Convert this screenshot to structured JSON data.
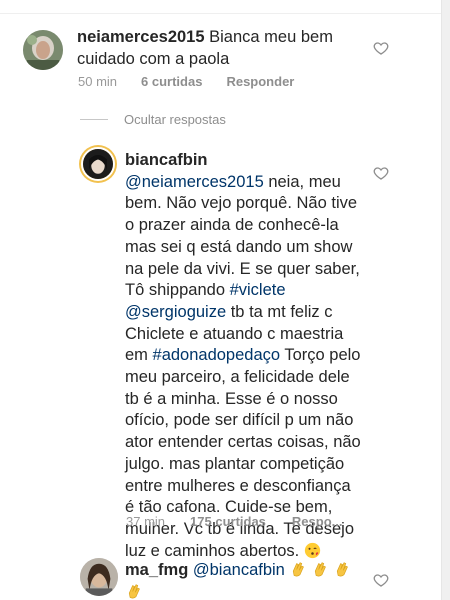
{
  "comments": [
    {
      "username": "neiamerces2015",
      "text": "Bianca meu bem cuidado com a paola",
      "time": "50 min",
      "likes": "6 curtidas",
      "reply": "Responder"
    }
  ],
  "hide_replies_label": "Ocultar respostas",
  "reply": {
    "username": "biancafbin",
    "parts": [
      {
        "type": "mention",
        "text": "@neiamerces2015"
      },
      {
        "type": "text",
        "text": " neia, meu bem. Não vejo porquê. Não tive o prazer ainda de conhecê-la mas sei q está dando um show na pele da vivi. E se quer saber, Tô shippando "
      },
      {
        "type": "hashtag",
        "text": "#viclete"
      },
      {
        "type": "text",
        "text": " "
      },
      {
        "type": "mention",
        "text": "@sergioguize"
      },
      {
        "type": "text",
        "text": " tb ta mt feliz c Chiclete e atuando c maestria em "
      },
      {
        "type": "hashtag",
        "text": "#adonadopedaço"
      },
      {
        "type": "text",
        "text": " Torço pelo meu parceiro, a felicidade dele tb é a minha.  Esse é o nosso ofício, pode ser difícil p um não ator entender certas coisas, não julgo. mas plantar competição entre mulheres e desconfiança é tão cafona. Cuide-se bem, mulher. Vc tb é linda. Te desejo luz e caminhos abertos. "
      }
    ],
    "emoji": "kissing-face-emoji",
    "time": "37 min",
    "likes": "175 curtidas",
    "reply_label": "Respo..."
  },
  "third": {
    "username": "ma_fmg",
    "mention": "@biancafbin",
    "emoji": "clapping-hands-emoji"
  },
  "colors": {
    "link": "#003569",
    "meta": "#999999",
    "text": "#262626"
  }
}
